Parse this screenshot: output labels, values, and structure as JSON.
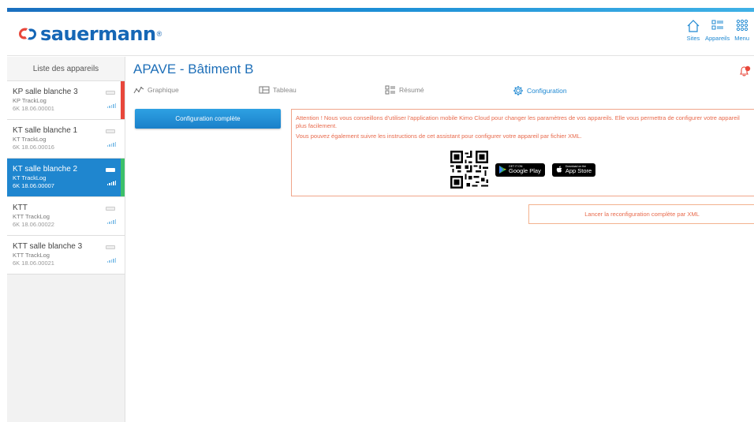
{
  "header": {
    "logo_text": "sauermann",
    "brand_color": "#1667b6",
    "nav": [
      {
        "label": "Sites",
        "icon": "home-icon"
      },
      {
        "label": "Appareils",
        "icon": "list-icon"
      },
      {
        "label": "Menu",
        "icon": "grid-icon"
      }
    ]
  },
  "sidebar": {
    "title": "Liste des appareils",
    "devices": [
      {
        "name": "KP salle blanche 3",
        "type": "KP TrackLog",
        "serial": "6K 18.06.00001",
        "flag_color": "#e8473b",
        "active": false
      },
      {
        "name": "KT salle blanche 1",
        "type": "KT TrackLog",
        "serial": "6K 18.06.00016",
        "flag_color": "",
        "active": false
      },
      {
        "name": "KT salle blanche 2",
        "type": "KT TrackLog",
        "serial": "6K 18.06.00007",
        "flag_color": "#3cc06a",
        "active": true
      },
      {
        "name": "KTT",
        "type": "KTT TrackLog",
        "serial": "6K 18.06.00022",
        "flag_color": "",
        "active": false
      },
      {
        "name": "KTT salle blanche 3",
        "type": "KTT TrackLog",
        "serial": "6K 18.06.00021",
        "flag_color": "",
        "active": false
      }
    ]
  },
  "main": {
    "title": "APAVE - Bâtiment B",
    "tabs": [
      {
        "label": "Graphique",
        "icon": "line-chart-icon",
        "active": false
      },
      {
        "label": "Tableau",
        "icon": "table-icon",
        "active": false
      },
      {
        "label": "Résumé",
        "icon": "summary-icon",
        "active": false
      },
      {
        "label": "Configuration",
        "icon": "gear-icon",
        "active": true
      }
    ],
    "config_button": "Configuration complète",
    "alert_text_1": "Attention ! Nous vous conseillons d'utiliser l'application mobile Kimo Cloud pour changer les paramètres de vos appareils. Elle vous permettra de configurer votre appareil plus facilement.",
    "alert_text_2": "Vous pouvez également suivre les instructions de cet assistant pour configurer votre appareil par fichier XML.",
    "google_play": {
      "small": "GET IT ON",
      "big": "Google Play"
    },
    "app_store": {
      "small": "Download on the",
      "big": "App Store"
    },
    "xml_button": "Lancer la reconfiguration complète par XML",
    "accent_color": "#1e88d2",
    "warning_color": "#e86a4c"
  }
}
